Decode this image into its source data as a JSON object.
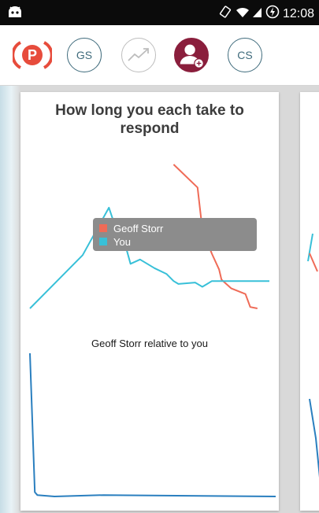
{
  "status_bar": {
    "time": "12:08",
    "icons": [
      "android-icon",
      "rotate-icon",
      "wifi-icon",
      "signal-icon",
      "data-saver-icon"
    ]
  },
  "toolbar": {
    "app_logo": "P",
    "buttons": [
      {
        "label": "GS"
      },
      {
        "label": ""
      },
      {
        "label": ""
      },
      {
        "label": "CS"
      }
    ]
  },
  "card": {
    "title": "How long you each take to respond",
    "subtitle": "Geoff Storr relative to you"
  },
  "chart_data": [
    {
      "type": "line",
      "series": [
        {
          "name": "Geoff Storr",
          "color": "#ef6b57",
          "points": [
            [
              0.6,
              0.0
            ],
            [
              0.7,
              0.16
            ],
            [
              0.72,
              0.45
            ],
            [
              0.76,
              0.62
            ],
            [
              0.79,
              0.73
            ],
            [
              0.8,
              0.8
            ],
            [
              0.84,
              0.86
            ],
            [
              0.9,
              0.9
            ],
            [
              0.92,
              0.99
            ],
            [
              0.95,
              1.0
            ]
          ]
        },
        {
          "name": "You",
          "color": "#38c0d8",
          "points": [
            [
              0.0,
              1.0
            ],
            [
              0.22,
              0.63
            ],
            [
              0.33,
              0.3
            ],
            [
              0.35,
              0.4
            ],
            [
              0.37,
              0.59
            ],
            [
              0.39,
              0.51
            ],
            [
              0.42,
              0.69
            ],
            [
              0.46,
              0.66
            ],
            [
              0.49,
              0.69
            ],
            [
              0.52,
              0.72
            ],
            [
              0.57,
              0.76
            ],
            [
              0.6,
              0.81
            ],
            [
              0.62,
              0.83
            ],
            [
              0.69,
              0.82
            ],
            [
              0.72,
              0.85
            ],
            [
              0.74,
              0.83
            ],
            [
              0.76,
              0.81
            ],
            [
              1.0,
              0.81
            ]
          ]
        }
      ]
    },
    {
      "type": "line",
      "series": [
        {
          "color": "#2a7fbf",
          "points": [
            [
              0.0,
              0.0
            ],
            [
              0.02,
              0.97
            ],
            [
              0.03,
              0.99
            ],
            [
              0.1,
              1.0
            ],
            [
              0.3,
              0.99
            ],
            [
              1.0,
              1.0
            ]
          ]
        }
      ]
    }
  ]
}
